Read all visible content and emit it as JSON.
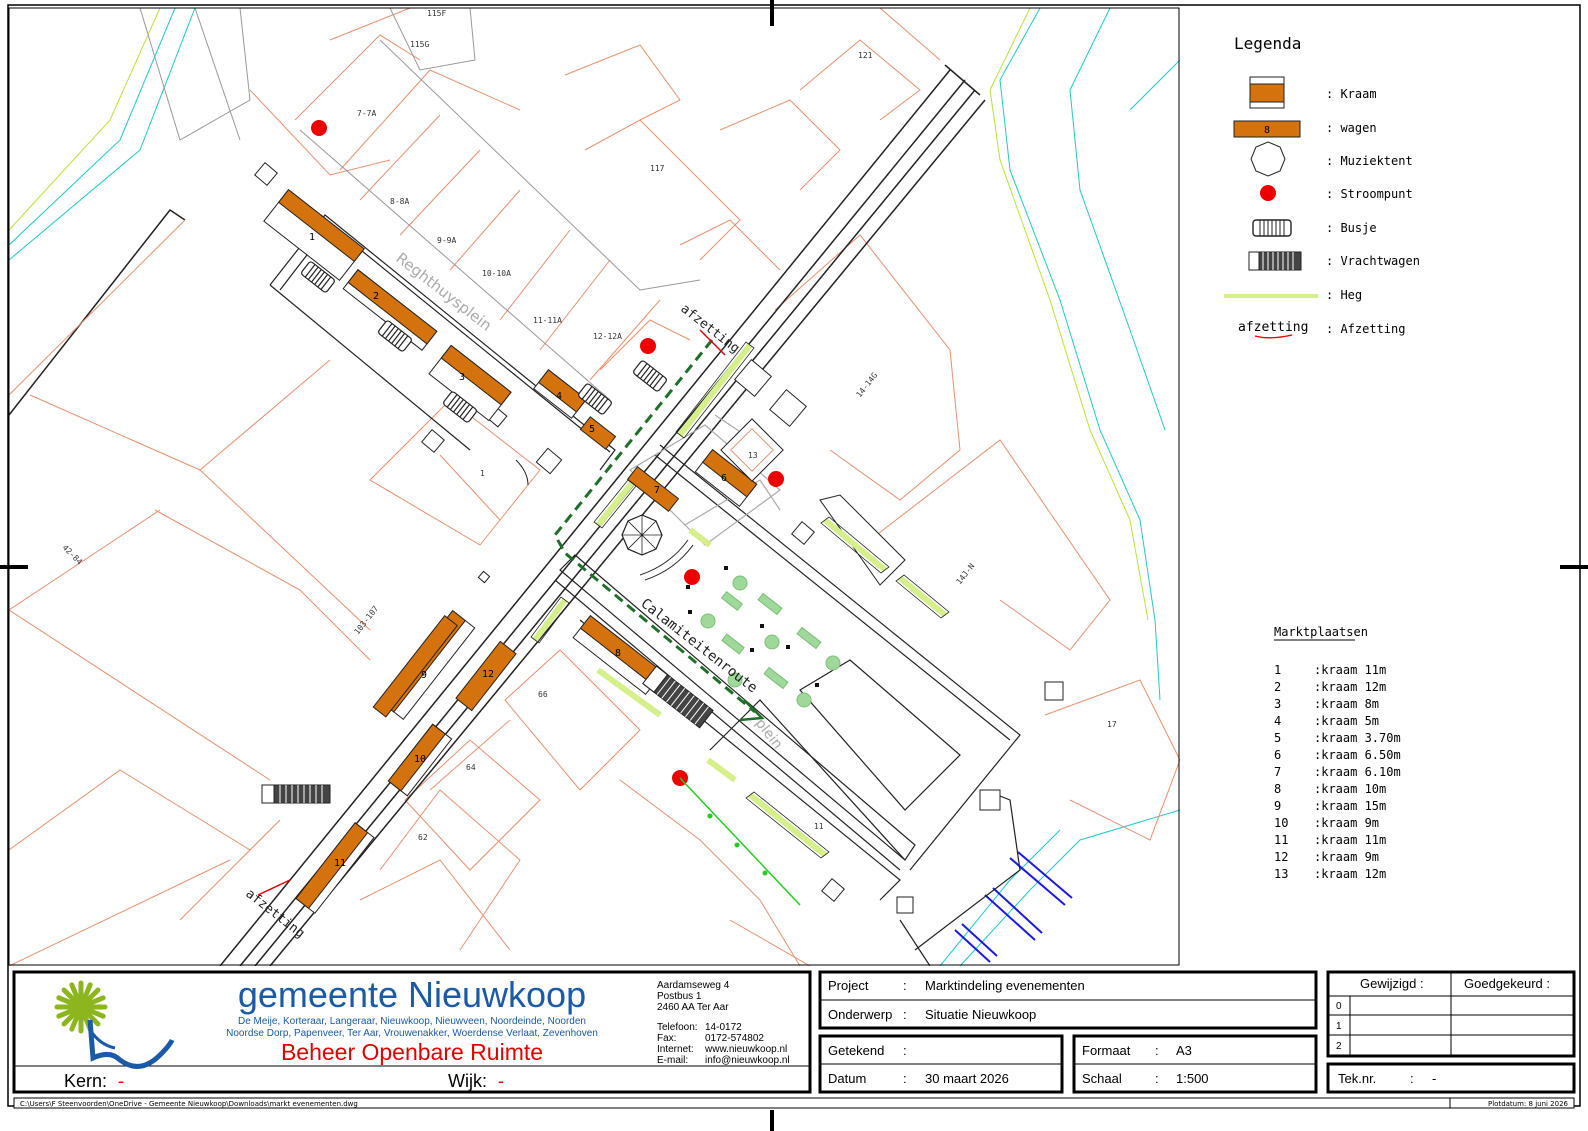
{
  "legend": {
    "title": "Legenda",
    "items": [
      {
        "symbol": "kraam",
        "label": ": Kraam"
      },
      {
        "symbol": "wagen",
        "number": "8",
        "label": ": wagen"
      },
      {
        "symbol": "muziektent",
        "label": ": Muziektent"
      },
      {
        "symbol": "stroompunt",
        "label": ": Stroompunt"
      },
      {
        "symbol": "busje",
        "label": ": Busje"
      },
      {
        "symbol": "vrachtwagen",
        "label": ": Vrachtwagen"
      },
      {
        "symbol": "heg",
        "label": ": Heg"
      },
      {
        "symbol": "afzetting",
        "text": "afzetting",
        "label": ": Afzetting"
      }
    ]
  },
  "marktplaatsen": {
    "title": "Marktplaatsen",
    "rows": [
      {
        "nr": "1",
        "desc": ":kraam 11m"
      },
      {
        "nr": "2",
        "desc": ":kraam 12m"
      },
      {
        "nr": "3",
        "desc": ":kraam 8m"
      },
      {
        "nr": "4",
        "desc": ":kraam 5m"
      },
      {
        "nr": "5",
        "desc": ":kraam 3.70m"
      },
      {
        "nr": "6",
        "desc": ":kraam 6.50m"
      },
      {
        "nr": "7",
        "desc": ":kraam 6.10m"
      },
      {
        "nr": "8",
        "desc": ":kraam 10m"
      },
      {
        "nr": "9",
        "desc": ":kraam 15m"
      },
      {
        "nr": "10",
        "desc": ":kraam 9m"
      },
      {
        "nr": "11",
        "desc": ":kraam 11m"
      },
      {
        "nr": "12",
        "desc": ":kraam 9m"
      },
      {
        "nr": "13",
        "desc": ":kraam 12m"
      }
    ]
  },
  "map": {
    "streets": {
      "reghthuysplein": "Reghthuysplein",
      "calamiteitenroute": "Calamiteitenroute",
      "plein": "plein"
    },
    "afzetting_top": "afzetting",
    "afzetting_bottom": "afzetting",
    "parcels": {
      "p115f": "115F",
      "p115g": "115G",
      "p121": "121",
      "p7_7a": "7-7A",
      "p117": "117",
      "p8_8a": "8-8A",
      "p9_9a": "9-9A",
      "p10_10a": "10-10A",
      "p11_11a": "11-11A",
      "p12_12a": "12-12A",
      "p14_14g": "14-14G",
      "p1": "1",
      "p42_84": "42-84",
      "p14j_n": "14J-N",
      "p103_107": "103-107",
      "p66": "66",
      "p64": "64",
      "p62": "62",
      "p11": "11",
      "p17": "17",
      "p13": "13"
    },
    "stalls": {
      "s1": "1",
      "s2": "2",
      "s3": "3",
      "s4": "4",
      "s5": "5",
      "s6": "6",
      "s7": "7",
      "s8": "8",
      "s9": "9",
      "s10": "10",
      "s11": "11",
      "s12": "12"
    }
  },
  "titleblock": {
    "org_name": "gemeente Nieuwkoop",
    "villages_1": "De Meije, Korteraar, Langeraar, Nieuwkoop, Nieuwveen, Noordeinde, Noorden",
    "villages_2": "Noordse Dorp, Papenveer, Ter Aar, Vrouwenakker, Woerdense Verlaat, Zevenhoven",
    "department": "Beheer Openbare Ruimte",
    "address_1": "Aardamseweg 4",
    "address_2": "Postbus 1",
    "address_3": "2460 AA Ter Aar",
    "tel_label": "Telefoon:",
    "tel": "14-0172",
    "fax_label": "Fax:",
    "fax": "0172-574802",
    "internet_label": "Internet:",
    "internet": "www.nieuwkoop.nl",
    "email_label": "E-mail:",
    "email": "info@nieuwkoop.nl",
    "kern_label": "Kern:",
    "kern_value": "-",
    "wijk_label": "Wijk:",
    "wijk_value": "-",
    "project_label": "Project",
    "project_sep": ":",
    "project_value": "Marktindeling evenementen",
    "onderwerp_label": "Onderwerp",
    "onderwerp_sep": ":",
    "onderwerp_value": "Situatie Nieuwkoop",
    "getekend_label": "Getekend",
    "getekend_sep": ":",
    "datum_label": "Datum",
    "datum_sep": ":",
    "datum_value": "30 maart 2026",
    "formaat_label": "Formaat",
    "formaat_sep": ":",
    "formaat_value": "A3",
    "schaal_label": "Schaal",
    "schaal_sep": ":",
    "schaal_value": "1:500",
    "gewijzigd_label": "Gewijzigd :",
    "goedgekeurd_label": "Goedgekeurd :",
    "rev_0": "0",
    "rev_1": "1",
    "rev_2": "2",
    "teknr_label": "Tek.nr.",
    "teknr_sep": ":",
    "teknr_value": "-",
    "filepath": "C:\\Users\\F Steenvoorden\\OneDrive - Gemeente Nieuwkoop\\Downloads\\markt evenementen.dwg",
    "plotdatum": "Plotdatum: 8 juni 2026"
  },
  "colors": {
    "kraam": "#d4730d",
    "parcel": "#e8906f",
    "heg": "#d5ef8a",
    "stroompunt": "#ee0000",
    "route": "#1f6f2a",
    "brand_blue": "#1a5aa6",
    "brand_green": "#8db61e",
    "dept_red": "#e00000",
    "water": "#22c8c8",
    "tree": "#9fd89a"
  }
}
